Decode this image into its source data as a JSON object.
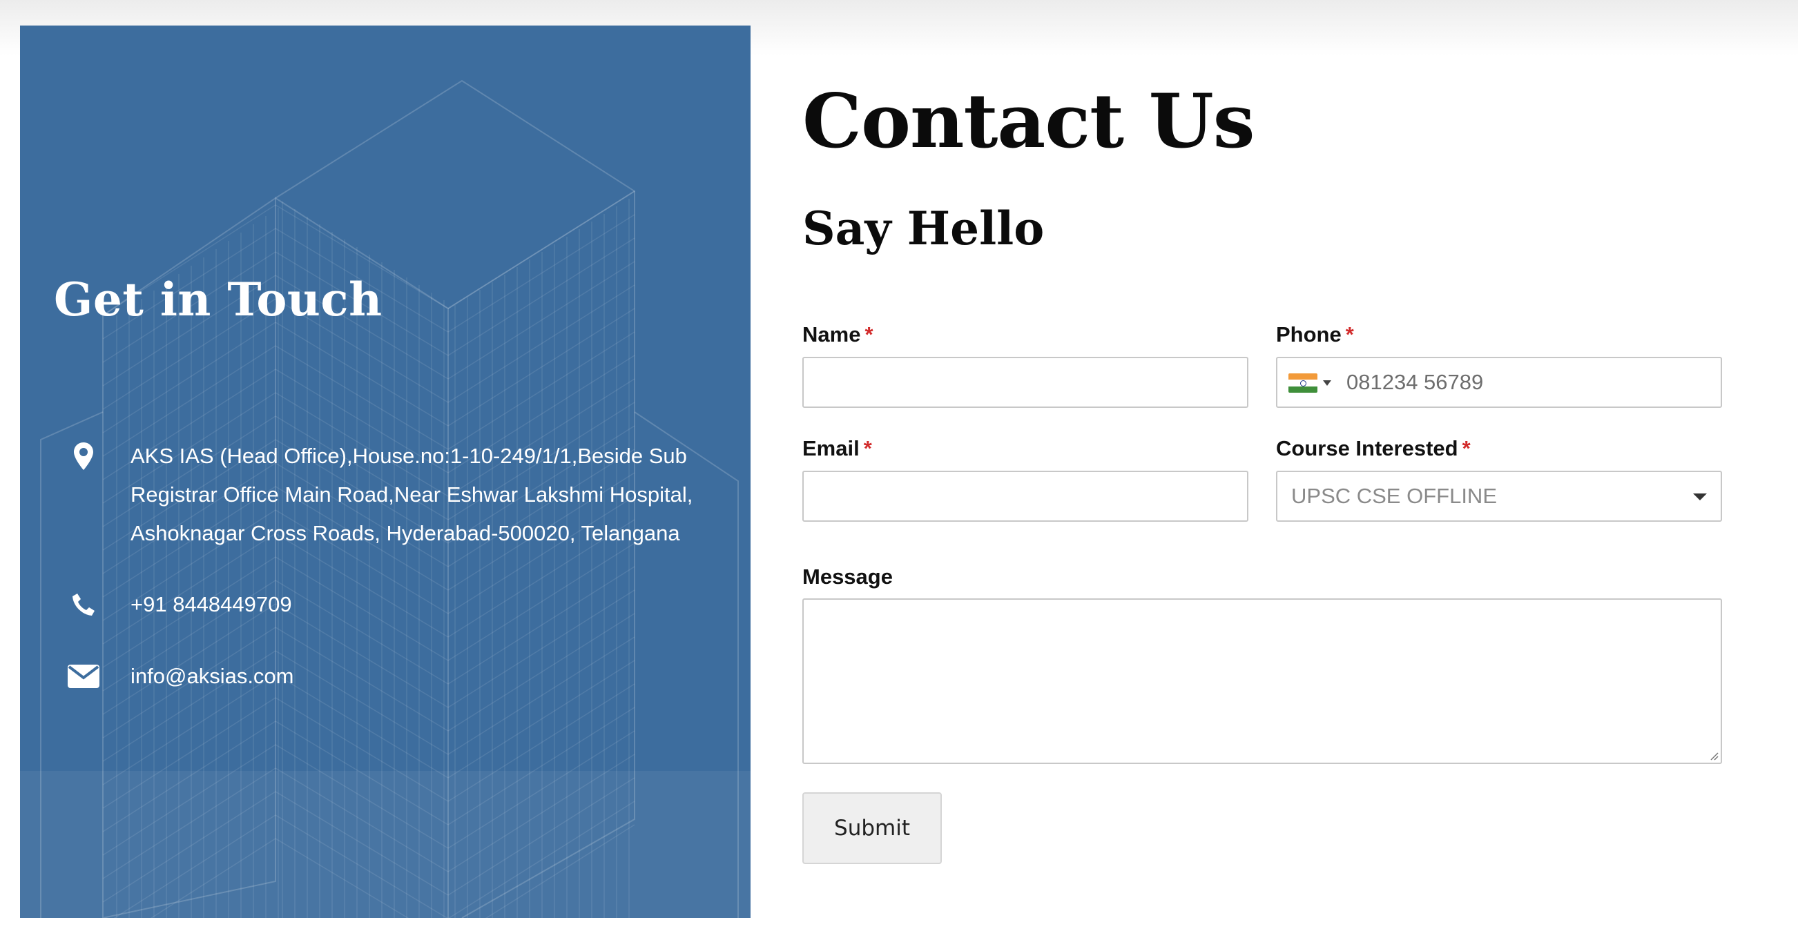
{
  "left_panel": {
    "title": "Get in Touch",
    "address": "AKS IAS (Head Office),House.no:1-10-249/1/1,Beside Sub Registrar Office Main Road,Near Eshwar Lakshmi Hospital, Ashoknagar Cross Roads, Hyderabad-500020, Telangana",
    "address_lines": [
      "AKS IAS (Head Office),House.no:1-10-249/1/1,Beside Sub",
      "Registrar Office Main Road,Near Eshwar Lakshmi Hospital,",
      "Ashoknagar Cross Roads, Hyderabad-500020, Telangana"
    ],
    "phone": "+91 8448449709",
    "email": "info@aksias.com",
    "icons": [
      "map-pin-icon",
      "phone-icon",
      "envelope-icon"
    ],
    "background_color": "#3d6d9e"
  },
  "form": {
    "heading": "Contact Us",
    "subheading": "Say Hello",
    "required_marker": "*",
    "name": {
      "label": "Name",
      "value": ""
    },
    "phone": {
      "label": "Phone",
      "placeholder": "081234 56789",
      "country_flag": "india-flag-icon"
    },
    "email": {
      "label": "Email",
      "value": ""
    },
    "course": {
      "label": "Course Interested",
      "selected": "UPSC CSE OFFLINE"
    },
    "message": {
      "label": "Message",
      "value": ""
    },
    "submit_label": "Submit"
  },
  "colors": {
    "required": "#d22b2b",
    "flag_saffron": "#f29a3a",
    "flag_white": "#ffffff",
    "flag_green": "#3f8f3a",
    "field_border": "#c8c8c8"
  }
}
